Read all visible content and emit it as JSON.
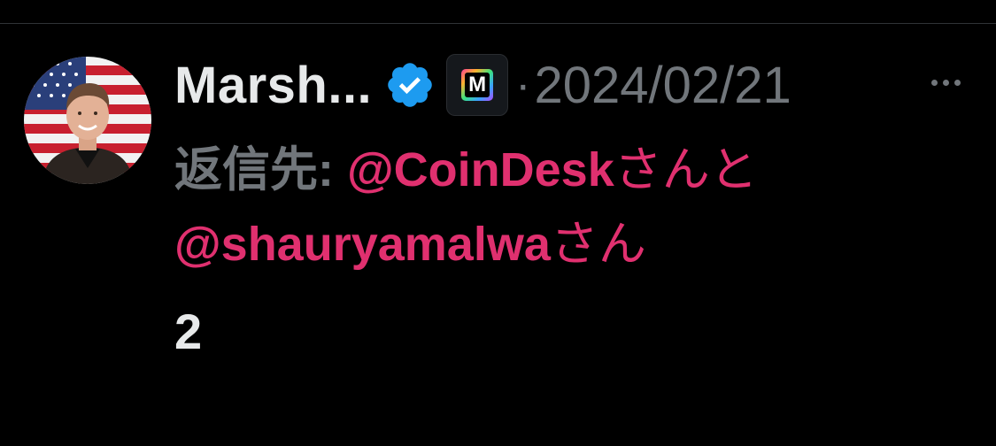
{
  "tweet": {
    "display_name": "Marsh...",
    "verified_icon": "verified-badge-icon",
    "affiliate_badge": {
      "icon": "m-logo-badge-icon",
      "letter": "M"
    },
    "separator": "·",
    "timestamp": "2024/02/21",
    "more_icon": "more-options-icon",
    "reply": {
      "label": "返信先:",
      "mention_1": "@CoinDesk",
      "connector": "さんと",
      "mention_2": "@shauryamalwa",
      "suffix": "さん"
    },
    "text": "2"
  },
  "colors": {
    "background": "#000000",
    "primary_text": "#e7e9ea",
    "secondary_text": "#71767b",
    "mention": "#e0306f",
    "verified": "#1d9bf0"
  }
}
